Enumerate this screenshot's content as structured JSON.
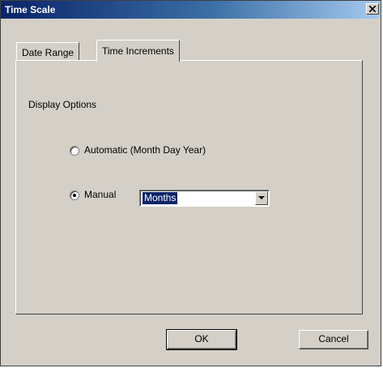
{
  "window": {
    "title": "Time Scale",
    "close_glyph": "X",
    "close_icon": "close-icon"
  },
  "tabs": [
    {
      "label": "Date Range",
      "active": false
    },
    {
      "label": "Time Increments",
      "active": true
    }
  ],
  "panel": {
    "group_label": "Display Options",
    "options": [
      {
        "label": "Automatic (Month Day Year)",
        "selected": false
      },
      {
        "label": "Manual",
        "selected": true
      }
    ],
    "increment_select": {
      "value": "Months",
      "arrow_icon": "chevron-down-icon"
    }
  },
  "buttons": {
    "ok": "OK",
    "cancel": "Cancel"
  },
  "colors": {
    "titlebar_start": "#0a246a",
    "titlebar_end": "#a6caf0",
    "face": "#d4d0c8",
    "selection": "#0a246a"
  }
}
